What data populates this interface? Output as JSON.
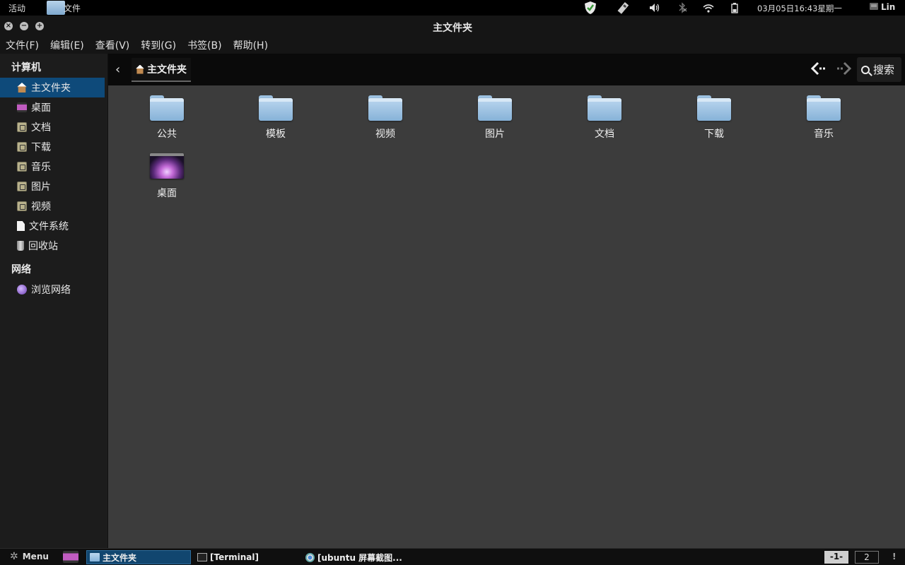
{
  "topbar": {
    "activities": "活动",
    "app_name": "文件",
    "clock": "03月05日16:43星期一",
    "user": "Lin",
    "tray_icons": [
      "shield-check-icon",
      "usb-stick-icon",
      "volume-icon",
      "bluetooth-off-icon",
      "wifi-icon",
      "battery-icon"
    ]
  },
  "window": {
    "title": "主文件夹",
    "buttons": [
      "close",
      "minimize",
      "maximize"
    ]
  },
  "menubar": {
    "items": [
      "文件(F)",
      "编辑(E)",
      "查看(V)",
      "转到(G)",
      "书签(B)",
      "帮助(H)"
    ]
  },
  "sidebar": {
    "computer_header": "计算机",
    "items": [
      {
        "label": "主文件夹",
        "icon": "home-icon",
        "selected": true
      },
      {
        "label": "桌面",
        "icon": "desktop-icon"
      },
      {
        "label": "文档",
        "icon": "folder-icon"
      },
      {
        "label": "下载",
        "icon": "folder-icon"
      },
      {
        "label": "音乐",
        "icon": "folder-icon"
      },
      {
        "label": "图片",
        "icon": "folder-icon"
      },
      {
        "label": "视频",
        "icon": "folder-icon"
      },
      {
        "label": "文件系统",
        "icon": "file-icon"
      },
      {
        "label": "回收站",
        "icon": "trash-icon"
      }
    ],
    "network_header": "网络",
    "network_items": [
      {
        "label": "浏览网络",
        "icon": "network-icon"
      }
    ]
  },
  "pathbar": {
    "current": "主文件夹",
    "search_label": "搜索"
  },
  "files": [
    {
      "name": "公共",
      "type": "folder"
    },
    {
      "name": "模板",
      "type": "folder"
    },
    {
      "name": "视频",
      "type": "folder"
    },
    {
      "name": "图片",
      "type": "folder"
    },
    {
      "name": "文档",
      "type": "folder"
    },
    {
      "name": "下载",
      "type": "folder"
    },
    {
      "name": "音乐",
      "type": "folder"
    },
    {
      "name": "桌面",
      "type": "desktop"
    }
  ],
  "taskbar": {
    "menu_label": "Menu",
    "tasks": [
      {
        "label": "主文件夹",
        "icon": "folder-icon",
        "active": true
      },
      {
        "label": "[Terminal]",
        "icon": "terminal-icon"
      },
      {
        "label": "[ubuntu 屏幕截图...",
        "icon": "chrome-icon"
      }
    ],
    "workspaces": [
      "-1-",
      "2"
    ],
    "notification": "!"
  }
}
